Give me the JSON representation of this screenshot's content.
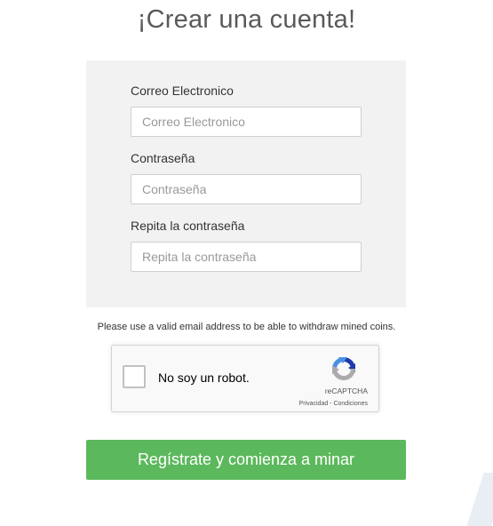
{
  "page": {
    "title": "¡Crear una cuenta!"
  },
  "form": {
    "email": {
      "label": "Correo Electronico",
      "placeholder": "Correo Electronico",
      "value": ""
    },
    "password": {
      "label": "Contraseña",
      "placeholder": "Contraseña",
      "value": ""
    },
    "repeat_password": {
      "label": "Repita la contraseña",
      "placeholder": "Repita la contraseña",
      "value": ""
    }
  },
  "notice": "Please use a valid email address to be able to withdraw mined coins.",
  "recaptcha": {
    "label": "No soy un robot.",
    "brand": "reCAPTCHA",
    "privacy": "Privacidad",
    "separator": " - ",
    "terms": "Condiciones",
    "icon": "recaptcha-logo-icon",
    "checked": false
  },
  "submit": {
    "label": "Regístrate y comienza a minar"
  },
  "colors": {
    "accent": "#5cb85c",
    "panel": "#f2f2f2",
    "title": "#5a5a5a",
    "recaptcha_blue": "#1c3aa9",
    "recaptcha_light_blue": "#4a90e2",
    "recaptcha_gray": "#ababab"
  }
}
